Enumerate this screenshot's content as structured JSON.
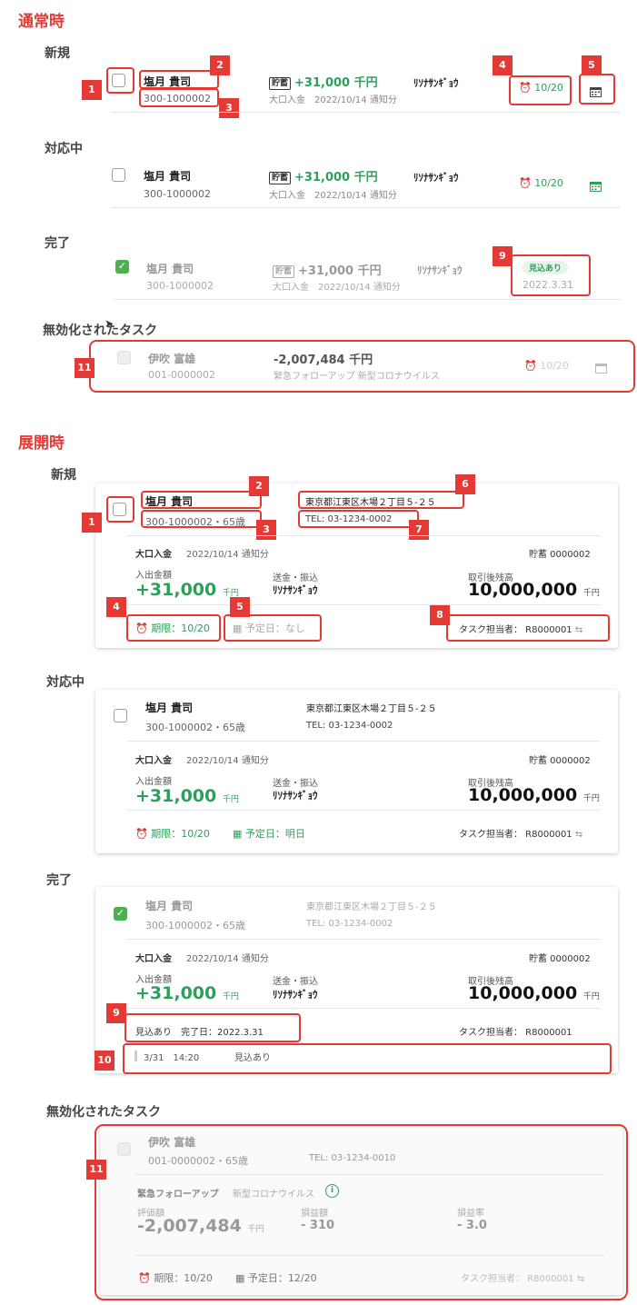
{
  "normal": {
    "title": "通常時",
    "new_title": "新規",
    "inprogress_title": "対応中",
    "done_title": "完了",
    "disabled_title": "無効化されたタスク",
    "row": {
      "name": "塩月 貴司",
      "code": "300-1000002",
      "tag": "貯蓄",
      "amount": "+31,000 千円",
      "sub": "大口入金　2022/10/14 通知分",
      "kata": "ﾘｿﾅｻﾝｷﾞｮｳ",
      "due": "10/20",
      "prospect": "見込あり",
      "done_date": "2022.3.31"
    },
    "disabled_row": {
      "name": "伊吹 富雄",
      "code": "001-0000002",
      "amount": "-2,007,484 千円",
      "sub": "緊急フォローアップ  新型コロナウイルス",
      "due": "10/20"
    }
  },
  "expanded": {
    "title": "展開時",
    "new_title": "新規",
    "inprogress_title": "対応中",
    "done_title": "完了",
    "disabled_title": "無効化されたタスク",
    "card": {
      "name": "塩月 貴司",
      "code": "300-1000002・65歳",
      "address": "東京都江東区木場２丁目５-２５",
      "tel": "TEL: 03-1234-0002",
      "type": "大口入金",
      "notice": "2022/10/14 通知分",
      "account": "貯蓄 0000002",
      "amount_label": "入出金額",
      "amount": "+31,000",
      "unit": "千円",
      "transfer_label": "送金・振込",
      "transfer_value": "ﾘｿﾅｻﾝｷﾞｮｳ",
      "balance_label": "取引後残高",
      "balance": "10,000,000",
      "due": "期限：10/20",
      "plan_none": "予定日：なし",
      "plan_tomorrow": "予定日：明日",
      "assignee": "タスク担当者： R8000001",
      "done_info": "見込あり　完了日：2022.3.31",
      "history_date": "3/31　14:20",
      "history_text": "見込あり"
    },
    "disabled_card": {
      "name": "伊吹 富雄",
      "code": "001-0000002・65歳",
      "tel": "TEL: 03-1234-0010",
      "type": "緊急フォローアップ",
      "reason": "新型コロナウイルス",
      "eval_label": "評価額",
      "eval": "-2,007,484",
      "unit": "千円",
      "pl_label": "損益額",
      "pl": "- 310",
      "rate_label": "損益率",
      "rate": "- 3.0",
      "due": "期限：10/20",
      "plan": "予定日：12/20",
      "assignee": "タスク担当者： R8000001"
    }
  },
  "badges": [
    "1",
    "2",
    "3",
    "4",
    "5",
    "6",
    "7",
    "8",
    "9",
    "10",
    "11"
  ]
}
